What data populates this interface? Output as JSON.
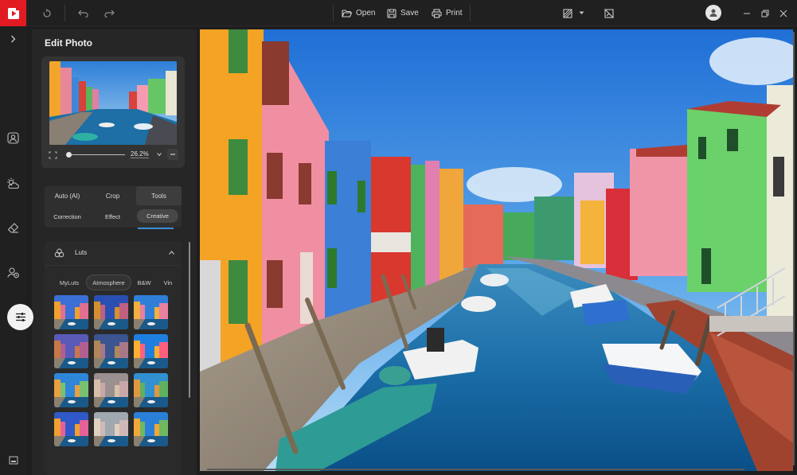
{
  "toolbar": {
    "open_label": "Open",
    "save_label": "Save",
    "print_label": "Print"
  },
  "panel": {
    "title": "Edit Photo",
    "zoom_value": "26.2%",
    "zoom_level": 0.02
  },
  "tabs": {
    "row1": [
      "Auto (AI)",
      "Crop",
      "Tools"
    ],
    "row2": [
      "Correction",
      "Effect",
      "Creative"
    ],
    "active_row1": "Tools",
    "active_row2": "Creative"
  },
  "luts": {
    "title": "Luts",
    "subtabs": [
      "MyLuts",
      "Atmosphere",
      "B&W",
      "Vin"
    ],
    "active_subtab": "Atmosphere"
  },
  "colors": {
    "brand_red": "#e21b23",
    "panel_bg": "#262626",
    "app_bg": "#1e1e1e"
  }
}
